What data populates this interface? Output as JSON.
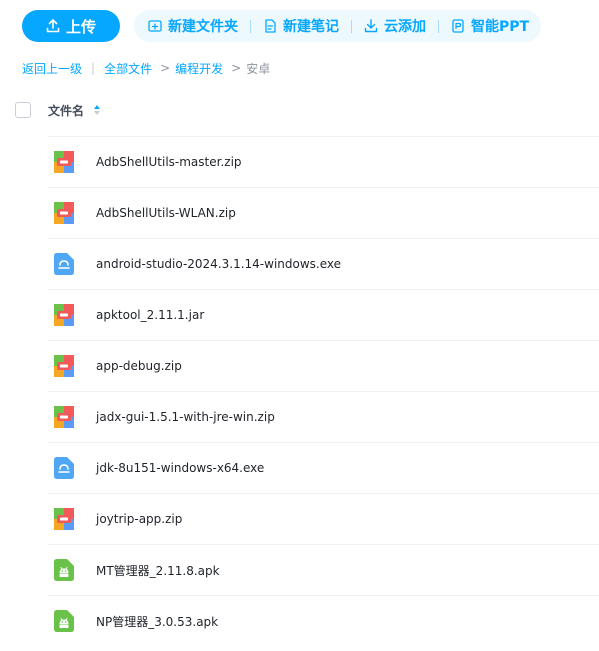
{
  "toolbar": {
    "upload_label": "上传",
    "actions": [
      {
        "label": "新建文件夹",
        "icon": "new-folder-icon"
      },
      {
        "label": "新建笔记",
        "icon": "new-note-icon"
      },
      {
        "label": "云添加",
        "icon": "cloud-add-icon"
      },
      {
        "label": "智能PPT",
        "icon": "smart-ppt-icon"
      }
    ]
  },
  "breadcrumb": {
    "back": "返回上一级",
    "items": [
      "全部文件",
      "编程开发"
    ],
    "current": "安卓"
  },
  "list": {
    "header": {
      "name": "文件名"
    },
    "files": [
      {
        "name": "AdbShellUtils-master.zip",
        "type": "archive-icon"
      },
      {
        "name": "AdbShellUtils-WLAN.zip",
        "type": "archive-icon"
      },
      {
        "name": "android-studio-2024.3.1.14-windows.exe",
        "type": "exe-icon"
      },
      {
        "name": "apktool_2.11.1.jar",
        "type": "archive-icon"
      },
      {
        "name": "app-debug.zip",
        "type": "archive-icon"
      },
      {
        "name": "jadx-gui-1.5.1-with-jre-win.zip",
        "type": "archive-icon"
      },
      {
        "name": "jdk-8u151-windows-x64.exe",
        "type": "exe-icon"
      },
      {
        "name": "joytrip-app.zip",
        "type": "archive-icon"
      },
      {
        "name": "MT管理器_2.11.8.apk",
        "type": "apk-icon"
      },
      {
        "name": "NP管理器_3.0.53.apk",
        "type": "apk-icon"
      }
    ]
  },
  "colors": {
    "accent": "#06a7ff",
    "accent_bg": "#eef9fe",
    "archive_orange": "#f5a623",
    "archive_blue": "#5a9bf7",
    "archive_red": "#f25a5a",
    "exe_blue": "#4fa7f5",
    "apk_green": "#6bc24a"
  }
}
